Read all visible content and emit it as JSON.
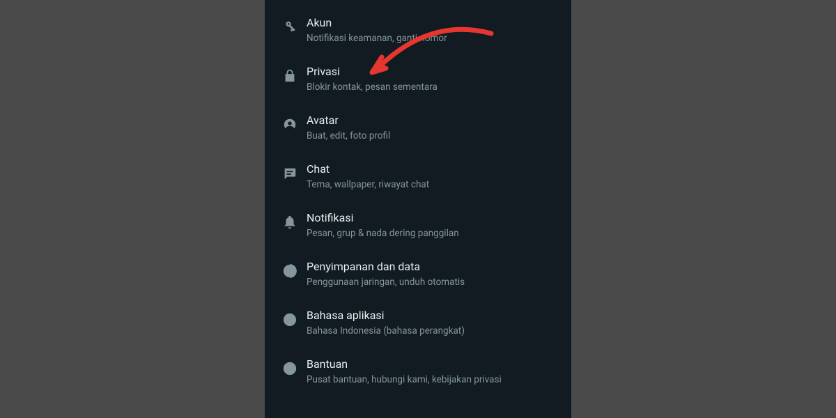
{
  "settings": {
    "items": [
      {
        "icon": "key-icon",
        "title": "Akun",
        "subtitle": "Notifikasi keamanan, ganti nomor"
      },
      {
        "icon": "lock-icon",
        "title": "Privasi",
        "subtitle": "Blokir kontak, pesan sementara"
      },
      {
        "icon": "avatar-icon",
        "title": "Avatar",
        "subtitle": "Buat, edit, foto profil"
      },
      {
        "icon": "chat-icon",
        "title": "Chat",
        "subtitle": "Tema, wallpaper, riwayat chat"
      },
      {
        "icon": "bell-icon",
        "title": "Notifikasi",
        "subtitle": "Pesan, grup & nada dering panggilan"
      },
      {
        "icon": "storage-icon",
        "title": "Penyimpanan dan data",
        "subtitle": "Penggunaan jaringan, unduh otomatis"
      },
      {
        "icon": "globe-icon",
        "title": "Bahasa aplikasi",
        "subtitle": "Bahasa Indonesia (bahasa perangkat)"
      },
      {
        "icon": "help-icon",
        "title": "Bantuan",
        "subtitle": "Pusat bantuan, hubungi kami, kebijakan privasi"
      }
    ]
  },
  "annotation": {
    "arrow_color": "#e6362f"
  }
}
